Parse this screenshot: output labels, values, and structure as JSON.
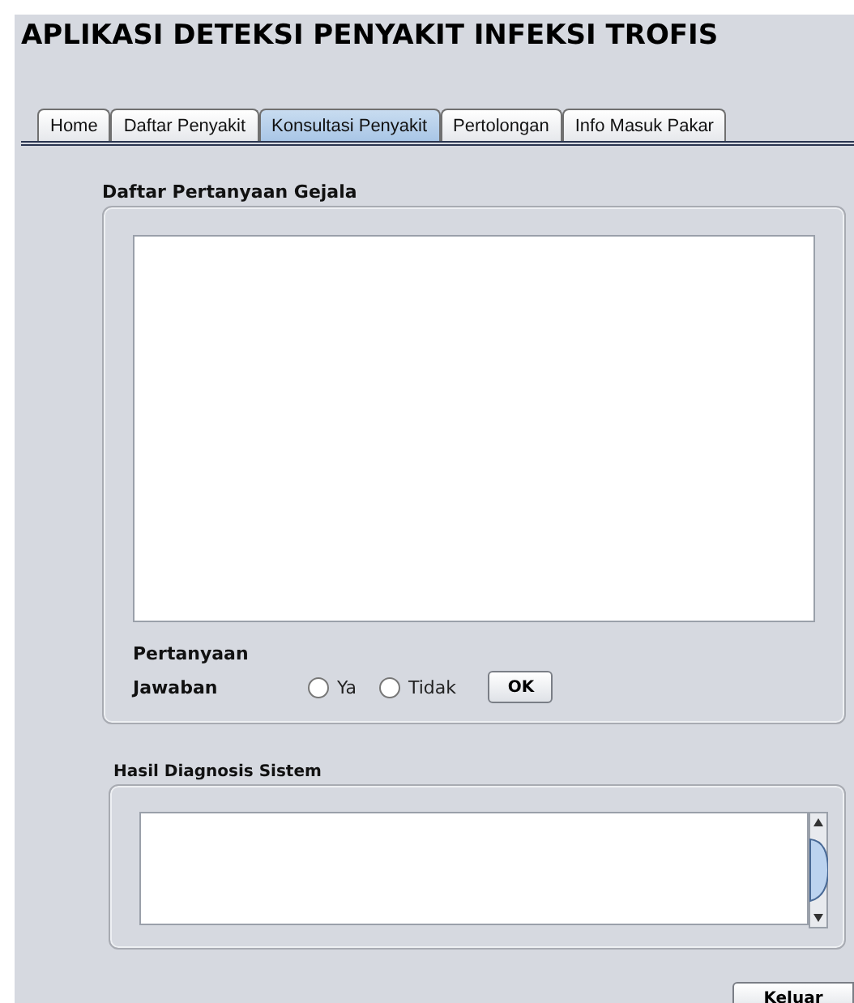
{
  "window": {
    "title": "APLIKASI DETEKSI PENYAKIT INFEKSI TROFIS"
  },
  "tabs": [
    {
      "label": "Home",
      "selected": false
    },
    {
      "label": "Daftar Penyakit",
      "selected": false
    },
    {
      "label": "Konsultasi Penyakit",
      "selected": true
    },
    {
      "label": "Pertolongan",
      "selected": false
    },
    {
      "label": "Info Masuk Pakar",
      "selected": false
    }
  ],
  "question_panel": {
    "title": "Daftar Pertanyaan Gejala",
    "question_label": "Pertanyaan",
    "answer_label": "Jawaban",
    "options": [
      {
        "label": "Ya",
        "selected": false
      },
      {
        "label": "Tidak",
        "selected": false
      }
    ],
    "ok_button": "OK"
  },
  "result_panel": {
    "title": "Hasil Diagnosis Sistem"
  },
  "exit_button": "Keluar"
}
